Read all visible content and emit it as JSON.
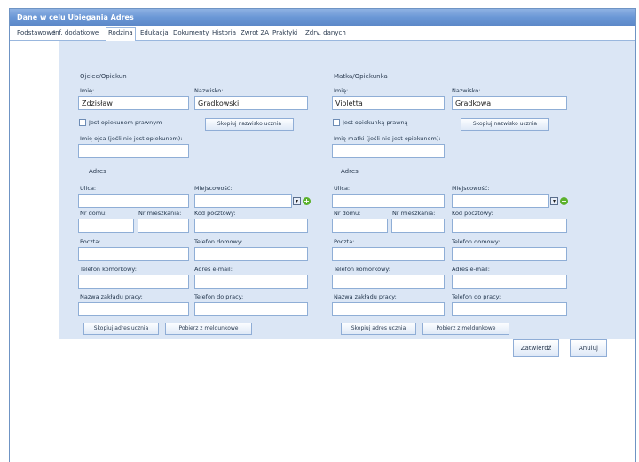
{
  "window": {
    "title": "Dane w celu Ubiegania Adres"
  },
  "tabs": [
    "Podstawowe",
    "Inf. dodatkowe",
    "Rodzina",
    "Edukacja",
    "Dokumenty",
    "Historia",
    "Zwrot ZA",
    "Praktyki",
    "Zdrv. danych"
  ],
  "active_tab": "Rodzina",
  "father": {
    "section": "Ojciec/Opiekun",
    "first_name_label": "Imię:",
    "first_name_value": "Zdzisław",
    "last_name_label": "Nazwisko:",
    "last_name_value": "Gradkowski",
    "checkbox_label": "Jest opiekunem prawnym",
    "copy_name_button": "Skopiuj nazwisko ucznia",
    "maiden_name_label": "Imię ojca (jeśli nie jest opiekunem):",
    "address_section": "Adres",
    "street_label": "Ulica:",
    "city_label": "Miejscowość:",
    "house_label": "Nr domu:",
    "flat_label": "Nr mieszkania:",
    "postcode_label": "Kod pocztowy:",
    "post_label": "Poczta:",
    "home_phone_label": "Telefon domowy:",
    "mobile_phone_label": "Telefon komórkowy:",
    "email_label": "Adres e-mail:",
    "workplace_label": "Nazwa zakładu pracy:",
    "work_phone_label": "Telefon do pracy:",
    "copy_address_button": "Skopiuj adres ucznia",
    "extra_button": "Pobierz z meldunkowe"
  },
  "mother": {
    "section": "Matka/Opiekunka",
    "first_name_label": "Imię:",
    "first_name_value": "Violetta",
    "last_name_label": "Nazwisko:",
    "last_name_value": "Gradkowa",
    "checkbox_label": "Jest opiekunką prawną",
    "copy_name_button": "Skopiuj nazwisko ucznia",
    "maiden_name_label": "Imię matki (jeśli nie jest opiekunem):",
    "address_section": "Adres",
    "street_label": "Ulica:",
    "city_label": "Miejscowość:",
    "house_label": "Nr domu:",
    "flat_label": "Nr mieszkania:",
    "postcode_label": "Kod pocztowy:",
    "post_label": "Poczta:",
    "home_phone_label": "Telefon domowy:",
    "mobile_phone_label": "Telefon komórkowy:",
    "email_label": "Adres e-mail:",
    "workplace_label": "Nazwa zakładu pracy:",
    "work_phone_label": "Telefon do pracy:",
    "copy_address_button": "Skopiuj adres ucznia",
    "extra_button": "Pobierz z meldunkowe"
  },
  "actions": {
    "save": "Zatwierdź",
    "cancel": "Anuluj"
  },
  "icons": {
    "dropdown": "chevron-down-icon",
    "add": "plus-icon"
  },
  "colors": {
    "title_bar": "#6a97d6",
    "panel": "#dbe6f5",
    "add_icon": "#5cb12c"
  }
}
